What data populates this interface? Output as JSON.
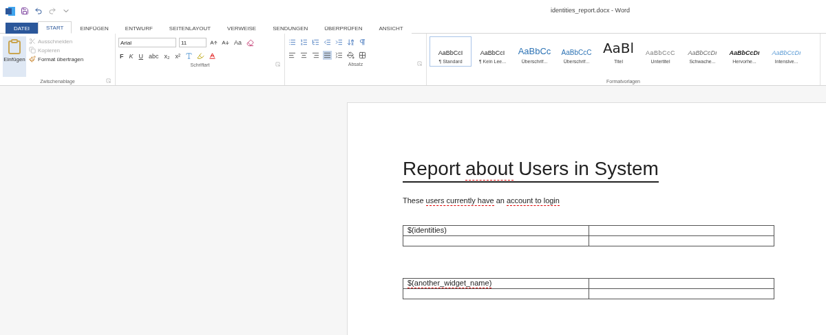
{
  "window": {
    "title": "identities_report.docx - Word"
  },
  "tabs": [
    {
      "label": "DATEI",
      "kind": "file",
      "selected": false
    },
    {
      "label": "START",
      "kind": "tab",
      "selected": true
    },
    {
      "label": "EINFÜGEN",
      "kind": "tab",
      "selected": false
    },
    {
      "label": "ENTWURF",
      "kind": "tab",
      "selected": false
    },
    {
      "label": "SEITENLAYOUT",
      "kind": "tab",
      "selected": false
    },
    {
      "label": "VERWEISE",
      "kind": "tab",
      "selected": false
    },
    {
      "label": "SENDUNGEN",
      "kind": "tab",
      "selected": false
    },
    {
      "label": "ÜBERPRÜFEN",
      "kind": "tab",
      "selected": false
    },
    {
      "label": "ANSICHT",
      "kind": "tab",
      "selected": false
    }
  ],
  "clipboard": {
    "paste": "Einfügen",
    "group": "Zwischenablage",
    "items": [
      {
        "label": "Ausschneiden",
        "disabled": true
      },
      {
        "label": "Kopieren",
        "disabled": true
      },
      {
        "label": "Format übertragen",
        "disabled": false
      }
    ]
  },
  "font": {
    "group": "Schriftart",
    "name": "Arial",
    "size": "11",
    "case_button": "Aa",
    "format_buttons": [
      "F",
      "K",
      "U",
      "abc",
      "x₂",
      "x²"
    ]
  },
  "paragraph": {
    "group": "Absatz",
    "align": [
      {
        "selected": false
      },
      {
        "selected": false
      },
      {
        "selected": false
      },
      {
        "selected": true
      }
    ]
  },
  "styles": {
    "group": "Formatvorlagen",
    "items": [
      {
        "preview": "AaBbCcI",
        "label": "¶ Standard",
        "kind": "normal",
        "selected": true
      },
      {
        "preview": "AaBbCcI",
        "label": "¶ Kein Lee...",
        "kind": "normal",
        "selected": false
      },
      {
        "preview": "AaBbCc",
        "label": "Überschrif...",
        "kind": "heading1",
        "selected": false
      },
      {
        "preview": "AaBbCcC",
        "label": "Überschrif...",
        "kind": "heading2",
        "selected": false
      },
      {
        "preview": "AaBl",
        "label": "Titel",
        "kind": "title",
        "selected": false
      },
      {
        "preview": "AaBbCcC",
        "label": "Untertitel",
        "kind": "subtitle",
        "selected": false
      },
      {
        "preview": "AaBbCcDı",
        "label": "Schwache...",
        "kind": "subtle",
        "selected": false
      },
      {
        "preview": "AaBbCcDı",
        "label": "Hervorhe...",
        "kind": "emphasis",
        "selected": false
      },
      {
        "preview": "AaBbCcDı",
        "label": "Intensive...",
        "kind": "intense",
        "selected": false
      }
    ]
  },
  "document": {
    "title": [
      {
        "text": "Report",
        "spell_error": false
      },
      {
        "text": "about",
        "spell_error": true
      },
      {
        "text": "Users in System",
        "spell_error": false
      }
    ],
    "paragraph": [
      {
        "text": "These",
        "spell_error": false
      },
      {
        "text": "users currently have",
        "spell_error": true
      },
      {
        "text": "an",
        "spell_error": false
      },
      {
        "text": "account to login",
        "spell_error": true
      }
    ],
    "tables": [
      {
        "first_cell": {
          "text": "$(identities)",
          "spell_error": false
        }
      },
      {
        "first_cell": {
          "text": "$(another_widget_name)",
          "spell_error": true
        }
      }
    ]
  }
}
